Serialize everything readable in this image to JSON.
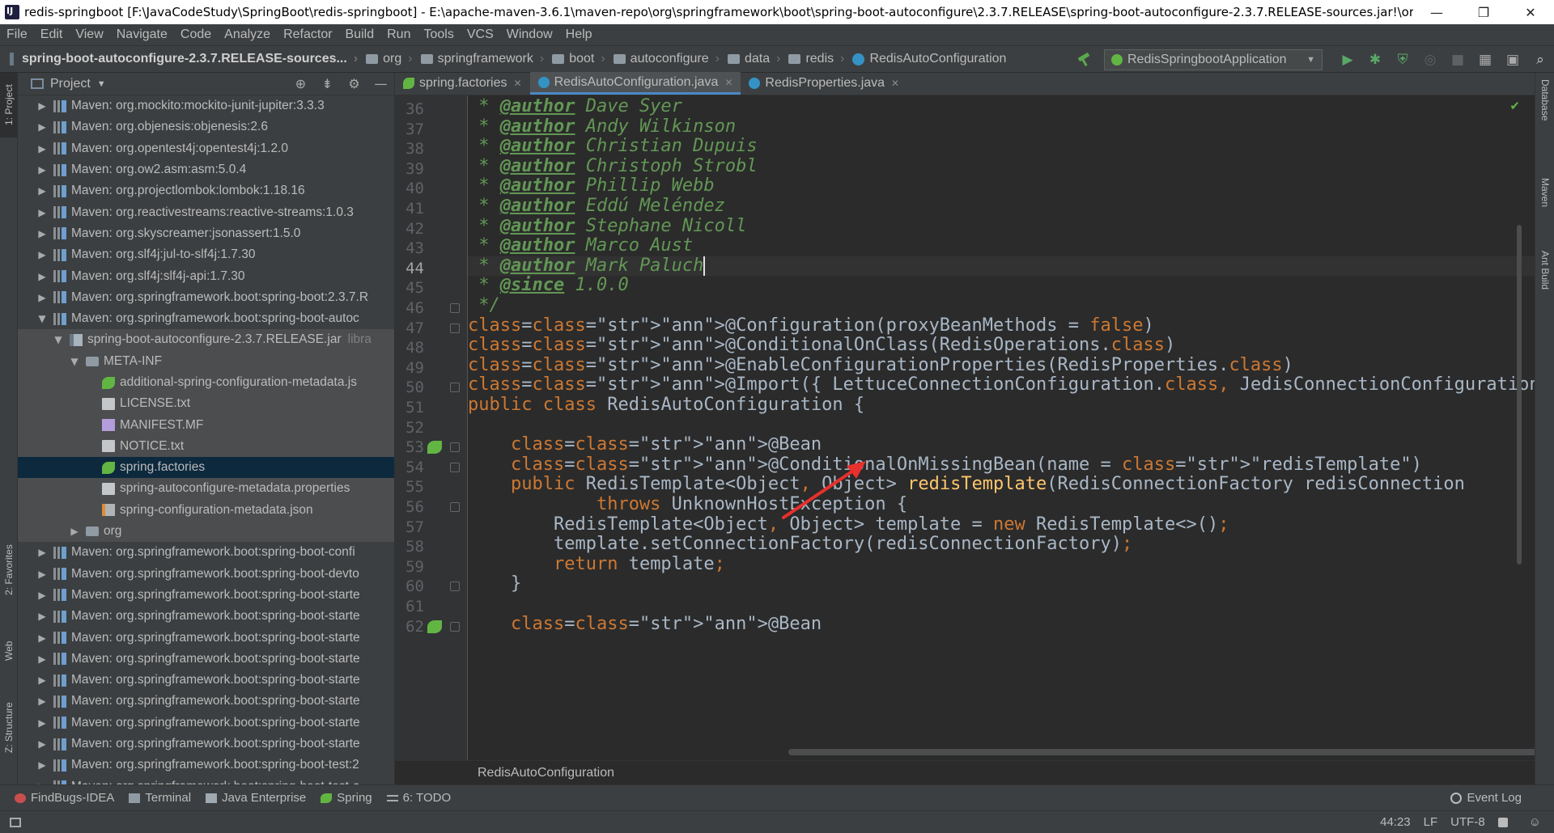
{
  "window": {
    "title": "redis-springboot [F:\\JavaCodeStudy\\SpringBoot\\redis-springboot] - E:\\apache-maven-3.6.1\\maven-repo\\org\\springframework\\boot\\spring-boot-autoconfigure\\2.3.7.RELEASE\\spring-boot-autoconfigure-2.3.7.RELEASE-sources.jar!\\or...",
    "minimize": "—",
    "restore": "❐",
    "close": "✕"
  },
  "menu": [
    "File",
    "Edit",
    "View",
    "Navigate",
    "Code",
    "Analyze",
    "Refactor",
    "Build",
    "Run",
    "Tools",
    "VCS",
    "Window",
    "Help"
  ],
  "nav": {
    "root": "spring-boot-autoconfigure-2.3.7.RELEASE-sources...",
    "crumbs": [
      "org",
      "springframework",
      "boot",
      "autoconfigure",
      "data",
      "redis"
    ],
    "file": "RedisAutoConfiguration",
    "run_config": "RedisSpringbootApplication"
  },
  "project_panel": {
    "title": "Project",
    "rows": [
      {
        "label": "Maven: org.mockito:mockito-junit-jupiter:3.3.3"
      },
      {
        "label": "Maven: org.objenesis:objenesis:2.6"
      },
      {
        "label": "Maven: org.opentest4j:opentest4j:1.2.0"
      },
      {
        "label": "Maven: org.ow2.asm:asm:5.0.4"
      },
      {
        "label": "Maven: org.projectlombok:lombok:1.18.16"
      },
      {
        "label": "Maven: org.reactivestreams:reactive-streams:1.0.3"
      },
      {
        "label": "Maven: org.skyscreamer:jsonassert:1.5.0"
      },
      {
        "label": "Maven: org.slf4j:jul-to-slf4j:1.7.30"
      },
      {
        "label": "Maven: org.slf4j:slf4j-api:1.7.30"
      },
      {
        "label": "Maven: org.springframework.boot:spring-boot:2.3.7.R"
      },
      {
        "label": "Maven: org.springframework.boot:spring-boot-autoc"
      },
      {
        "label": "spring-boot-autoconfigure-2.3.7.RELEASE.jar",
        "note": "libra"
      },
      {
        "label": "META-INF"
      },
      {
        "label": "additional-spring-configuration-metadata.js"
      },
      {
        "label": "LICENSE.txt"
      },
      {
        "label": "MANIFEST.MF"
      },
      {
        "label": "NOTICE.txt"
      },
      {
        "label": "spring.factories"
      },
      {
        "label": "spring-autoconfigure-metadata.properties"
      },
      {
        "label": "spring-configuration-metadata.json"
      },
      {
        "label": "org"
      },
      {
        "label": "Maven: org.springframework.boot:spring-boot-confi"
      },
      {
        "label": "Maven: org.springframework.boot:spring-boot-devto"
      },
      {
        "label": "Maven: org.springframework.boot:spring-boot-starte"
      },
      {
        "label": "Maven: org.springframework.boot:spring-boot-starte"
      },
      {
        "label": "Maven: org.springframework.boot:spring-boot-starte"
      },
      {
        "label": "Maven: org.springframework.boot:spring-boot-starte"
      },
      {
        "label": "Maven: org.springframework.boot:spring-boot-starte"
      },
      {
        "label": "Maven: org.springframework.boot:spring-boot-starte"
      },
      {
        "label": "Maven: org.springframework.boot:spring-boot-starte"
      },
      {
        "label": "Maven: org.springframework.boot:spring-boot-starte"
      },
      {
        "label": "Maven: org.springframework.boot:spring-boot-test:2"
      },
      {
        "label": "Maven: org.springframework.boot:spring-boot-test-a"
      }
    ]
  },
  "editor_tabs": [
    {
      "label": "spring.factories",
      "active": false
    },
    {
      "label": "RedisAutoConfiguration.java",
      "active": true
    },
    {
      "label": "RedisProperties.java",
      "active": false
    }
  ],
  "editor": {
    "current_line": 44,
    "lines": [
      {
        "n": "36",
        "text": " * @author Dave Syer"
      },
      {
        "n": "37",
        "text": " * @author Andy Wilkinson"
      },
      {
        "n": "38",
        "text": " * @author Christian Dupuis"
      },
      {
        "n": "39",
        "text": " * @author Christoph Strobl"
      },
      {
        "n": "40",
        "text": " * @author Phillip Webb"
      },
      {
        "n": "41",
        "text": " * @author Eddú Meléndez"
      },
      {
        "n": "42",
        "text": " * @author Stephane Nicoll"
      },
      {
        "n": "43",
        "text": " * @author Marco Aust"
      },
      {
        "n": "44",
        "text": " * @author Mark Paluch"
      },
      {
        "n": "45",
        "text": " * @since 1.0.0"
      },
      {
        "n": "46",
        "text": " */"
      },
      {
        "n": "47",
        "text": "@Configuration(proxyBeanMethods = false)"
      },
      {
        "n": "48",
        "text": "@ConditionalOnClass(RedisOperations.class)"
      },
      {
        "n": "49",
        "text": "@EnableConfigurationProperties(RedisProperties.class)"
      },
      {
        "n": "50",
        "text": "@Import({ LettuceConnectionConfiguration.class, JedisConnectionConfiguration.class })"
      },
      {
        "n": "51",
        "text": "public class RedisAutoConfiguration {"
      },
      {
        "n": "52",
        "text": ""
      },
      {
        "n": "53",
        "text": "    @Bean"
      },
      {
        "n": "54",
        "text": "    @ConditionalOnMissingBean(name = \"redisTemplate\")"
      },
      {
        "n": "55",
        "text": "    public RedisTemplate<Object, Object> redisTemplate(RedisConnectionFactory redisConnection"
      },
      {
        "n": "56",
        "text": "            throws UnknownHostException {"
      },
      {
        "n": "57",
        "text": "        RedisTemplate<Object, Object> template = new RedisTemplate<>();"
      },
      {
        "n": "58",
        "text": "        template.setConnectionFactory(redisConnectionFactory);"
      },
      {
        "n": "59",
        "text": "        return template;"
      },
      {
        "n": "60",
        "text": "    }"
      },
      {
        "n": "61",
        "text": ""
      },
      {
        "n": "62",
        "text": "    @Bean"
      }
    ]
  },
  "editor_breadcrumb": "RedisAutoConfiguration",
  "tool_windows": [
    "FindBugs-IDEA",
    "Terminal",
    "Java Enterprise",
    "Spring",
    "6: TODO"
  ],
  "event_log": "Event Log",
  "left_tabs": [
    "1: Project",
    "2: Favorites",
    "Web",
    "Z: Structure"
  ],
  "right_tabs": [
    "Database",
    "Maven",
    "Ant Build"
  ],
  "status": {
    "position": "44:23",
    "line_sep": "LF",
    "encoding": "UTF-8"
  }
}
